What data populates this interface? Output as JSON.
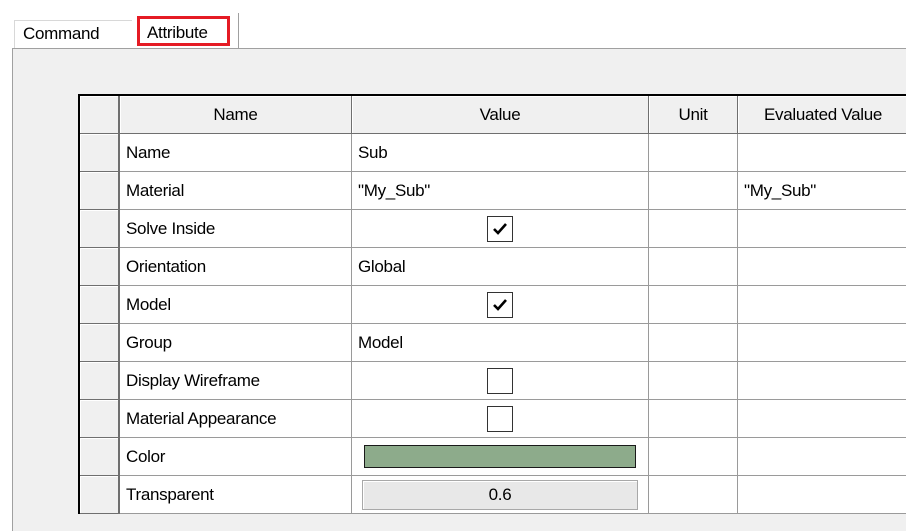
{
  "tabs": {
    "command_label": "Command",
    "attribute_label": "Attribute"
  },
  "columns": [
    "Name",
    "Value",
    "Unit",
    "Evaluated Value"
  ],
  "rows": [
    {
      "name": "Name",
      "value": "Sub",
      "unit": "",
      "evaluated": ""
    },
    {
      "name": "Material",
      "value": "\"My_Sub\"",
      "unit": "",
      "evaluated": "\"My_Sub\""
    },
    {
      "name": "Solve Inside",
      "checked": true
    },
    {
      "name": "Orientation",
      "value": "Global",
      "unit": "",
      "evaluated": ""
    },
    {
      "name": "Model",
      "checked": true
    },
    {
      "name": "Group",
      "value": "Model",
      "unit": "",
      "evaluated": ""
    },
    {
      "name": "Display Wireframe",
      "checked": false
    },
    {
      "name": "Material Appearance",
      "checked": false
    },
    {
      "name": "Color",
      "color": "#8dab8b"
    },
    {
      "name": "Transparent",
      "value": "0.6"
    }
  ],
  "colors": {
    "highlight_border": "#e51b24",
    "swatch_color": "#8dab8b"
  }
}
